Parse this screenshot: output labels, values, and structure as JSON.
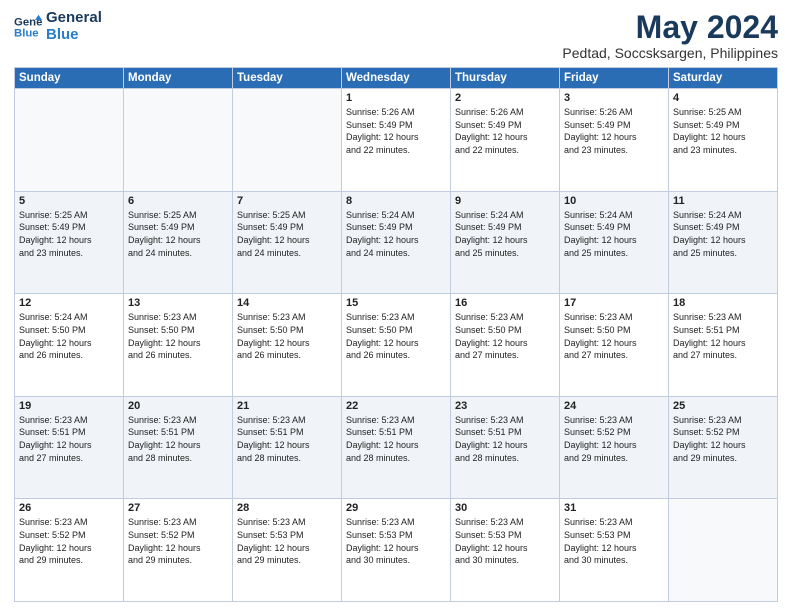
{
  "logo": {
    "line1": "General",
    "line2": "Blue"
  },
  "title": "May 2024",
  "subtitle": "Pedtad, Soccsksargen, Philippines",
  "weekdays": [
    "Sunday",
    "Monday",
    "Tuesday",
    "Wednesday",
    "Thursday",
    "Friday",
    "Saturday"
  ],
  "weeks": [
    [
      {
        "day": "",
        "text": ""
      },
      {
        "day": "",
        "text": ""
      },
      {
        "day": "",
        "text": ""
      },
      {
        "day": "1",
        "text": "Sunrise: 5:26 AM\nSunset: 5:49 PM\nDaylight: 12 hours\nand 22 minutes."
      },
      {
        "day": "2",
        "text": "Sunrise: 5:26 AM\nSunset: 5:49 PM\nDaylight: 12 hours\nand 22 minutes."
      },
      {
        "day": "3",
        "text": "Sunrise: 5:26 AM\nSunset: 5:49 PM\nDaylight: 12 hours\nand 23 minutes."
      },
      {
        "day": "4",
        "text": "Sunrise: 5:25 AM\nSunset: 5:49 PM\nDaylight: 12 hours\nand 23 minutes."
      }
    ],
    [
      {
        "day": "5",
        "text": "Sunrise: 5:25 AM\nSunset: 5:49 PM\nDaylight: 12 hours\nand 23 minutes."
      },
      {
        "day": "6",
        "text": "Sunrise: 5:25 AM\nSunset: 5:49 PM\nDaylight: 12 hours\nand 24 minutes."
      },
      {
        "day": "7",
        "text": "Sunrise: 5:25 AM\nSunset: 5:49 PM\nDaylight: 12 hours\nand 24 minutes."
      },
      {
        "day": "8",
        "text": "Sunrise: 5:24 AM\nSunset: 5:49 PM\nDaylight: 12 hours\nand 24 minutes."
      },
      {
        "day": "9",
        "text": "Sunrise: 5:24 AM\nSunset: 5:49 PM\nDaylight: 12 hours\nand 25 minutes."
      },
      {
        "day": "10",
        "text": "Sunrise: 5:24 AM\nSunset: 5:49 PM\nDaylight: 12 hours\nand 25 minutes."
      },
      {
        "day": "11",
        "text": "Sunrise: 5:24 AM\nSunset: 5:49 PM\nDaylight: 12 hours\nand 25 minutes."
      }
    ],
    [
      {
        "day": "12",
        "text": "Sunrise: 5:24 AM\nSunset: 5:50 PM\nDaylight: 12 hours\nand 26 minutes."
      },
      {
        "day": "13",
        "text": "Sunrise: 5:23 AM\nSunset: 5:50 PM\nDaylight: 12 hours\nand 26 minutes."
      },
      {
        "day": "14",
        "text": "Sunrise: 5:23 AM\nSunset: 5:50 PM\nDaylight: 12 hours\nand 26 minutes."
      },
      {
        "day": "15",
        "text": "Sunrise: 5:23 AM\nSunset: 5:50 PM\nDaylight: 12 hours\nand 26 minutes."
      },
      {
        "day": "16",
        "text": "Sunrise: 5:23 AM\nSunset: 5:50 PM\nDaylight: 12 hours\nand 27 minutes."
      },
      {
        "day": "17",
        "text": "Sunrise: 5:23 AM\nSunset: 5:50 PM\nDaylight: 12 hours\nand 27 minutes."
      },
      {
        "day": "18",
        "text": "Sunrise: 5:23 AM\nSunset: 5:51 PM\nDaylight: 12 hours\nand 27 minutes."
      }
    ],
    [
      {
        "day": "19",
        "text": "Sunrise: 5:23 AM\nSunset: 5:51 PM\nDaylight: 12 hours\nand 27 minutes."
      },
      {
        "day": "20",
        "text": "Sunrise: 5:23 AM\nSunset: 5:51 PM\nDaylight: 12 hours\nand 28 minutes."
      },
      {
        "day": "21",
        "text": "Sunrise: 5:23 AM\nSunset: 5:51 PM\nDaylight: 12 hours\nand 28 minutes."
      },
      {
        "day": "22",
        "text": "Sunrise: 5:23 AM\nSunset: 5:51 PM\nDaylight: 12 hours\nand 28 minutes."
      },
      {
        "day": "23",
        "text": "Sunrise: 5:23 AM\nSunset: 5:51 PM\nDaylight: 12 hours\nand 28 minutes."
      },
      {
        "day": "24",
        "text": "Sunrise: 5:23 AM\nSunset: 5:52 PM\nDaylight: 12 hours\nand 29 minutes."
      },
      {
        "day": "25",
        "text": "Sunrise: 5:23 AM\nSunset: 5:52 PM\nDaylight: 12 hours\nand 29 minutes."
      }
    ],
    [
      {
        "day": "26",
        "text": "Sunrise: 5:23 AM\nSunset: 5:52 PM\nDaylight: 12 hours\nand 29 minutes."
      },
      {
        "day": "27",
        "text": "Sunrise: 5:23 AM\nSunset: 5:52 PM\nDaylight: 12 hours\nand 29 minutes."
      },
      {
        "day": "28",
        "text": "Sunrise: 5:23 AM\nSunset: 5:53 PM\nDaylight: 12 hours\nand 29 minutes."
      },
      {
        "day": "29",
        "text": "Sunrise: 5:23 AM\nSunset: 5:53 PM\nDaylight: 12 hours\nand 30 minutes."
      },
      {
        "day": "30",
        "text": "Sunrise: 5:23 AM\nSunset: 5:53 PM\nDaylight: 12 hours\nand 30 minutes."
      },
      {
        "day": "31",
        "text": "Sunrise: 5:23 AM\nSunset: 5:53 PM\nDaylight: 12 hours\nand 30 minutes."
      },
      {
        "day": "",
        "text": ""
      }
    ]
  ]
}
